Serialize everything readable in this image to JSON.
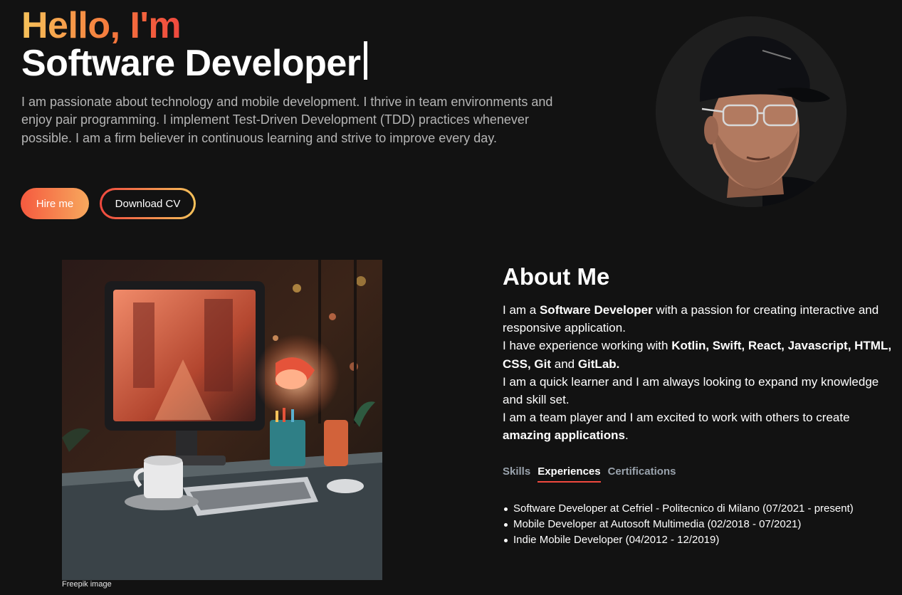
{
  "hero": {
    "greeting": "Hello, I'm",
    "role": "Software Developer",
    "bio": "I am passionate about technology and mobile development. I thrive in team environments and enjoy pair programming. I implement Test-Driven Development (TDD) practices whenever possible. I am a firm believer in continuous learning and strive to improve every day.",
    "hire_label": "Hire me",
    "cv_label": "Download CV"
  },
  "photo": {
    "credit": "Freepik image"
  },
  "about": {
    "title": "About Me",
    "p1_a": "I am a ",
    "p1_b": "Software Developer",
    "p1_c": " with a passion for creating interactive and responsive application.",
    "p2_a": "I have experience working with ",
    "p2_b": "Kotlin, Swift, React, Javascript, HTML, CSS, Git",
    "p2_c": " and ",
    "p2_d": "GitLab.",
    "p3": "I am a quick learner and I am always looking to expand my knowledge and skill set.",
    "p4_a": "I am a team player and I am excited to work with others to create ",
    "p4_b": "amazing applications",
    "p4_c": "."
  },
  "tabs": [
    {
      "label": "Skills"
    },
    {
      "label": "Experiences"
    },
    {
      "label": "Certifications"
    }
  ],
  "experiences": [
    "Software Developer at Cefriel - Politecnico di Milano (07/2021 - present)",
    "Mobile Developer at Autosoft Multimedia (02/2018 - 07/2021)",
    "Indie Mobile Developer (04/2012 - 12/2019)"
  ],
  "colors": {
    "background": "#121212",
    "accent_orange": "#f57a3c",
    "accent_red": "#f0483e",
    "accent_yellow": "#f6c25a"
  }
}
